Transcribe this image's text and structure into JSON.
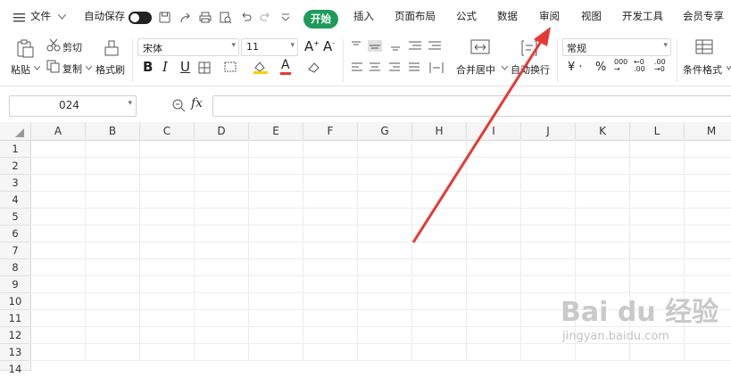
{
  "menubar": {
    "hamburger_icon": "menu-icon",
    "file_label": "文件",
    "autosave_label": "自动保存",
    "tabs": [
      "开始",
      "插入",
      "页面布局",
      "公式",
      "数据",
      "审阅",
      "视图",
      "开发工具",
      "会员专享"
    ]
  },
  "ribbon": {
    "paste": "粘贴",
    "cut": "剪切",
    "copy": "复制",
    "format_painter": "格式刷",
    "font_name": "宋体",
    "font_size": "11",
    "merge_center": "合并居中",
    "wrap_text": "自动换行",
    "number_format": "常规",
    "conditional_format": "条件格式"
  },
  "formula_bar": {
    "name_box": "024",
    "fx_label": "fx",
    "formula_value": ""
  },
  "sheet": {
    "columns": [
      "A",
      "B",
      "C",
      "D",
      "E",
      "F",
      "G",
      "H",
      "I",
      "J",
      "K",
      "L",
      "M"
    ],
    "rows": [
      "1",
      "2",
      "3",
      "4",
      "5",
      "6",
      "7",
      "8",
      "9",
      "10",
      "11",
      "12",
      "13",
      "14"
    ]
  },
  "watermark": {
    "logo_text": "Bai du 经验",
    "url_text": "jingyan.baidu.com"
  },
  "colors": {
    "accent_green": "#1e9b5b",
    "arrow_red": "#e53935"
  }
}
